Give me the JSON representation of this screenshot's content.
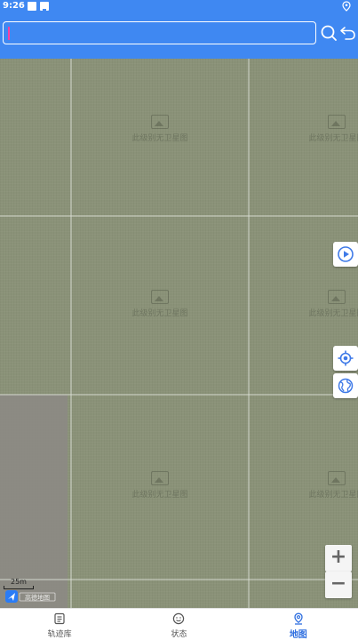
{
  "status_bar": {
    "time": "9:26",
    "icons": [
      "square-icon",
      "notification-icon",
      "location-icon"
    ]
  },
  "search": {
    "value": "",
    "placeholder": "",
    "search_icon": "search-icon",
    "back_icon": "return-icon"
  },
  "map": {
    "tile_placeholder_text": "此级别无卫星图",
    "scale_label": "25m",
    "logo_text": "高德地图",
    "controls": {
      "play": "play-icon",
      "locate": "locate-icon",
      "layers": "globe-icon",
      "zoom_in": "+",
      "zoom_out": "−"
    }
  },
  "bottom_nav": {
    "tabs": [
      {
        "label": "轨迹库",
        "icon": "list-doc-icon",
        "active": false
      },
      {
        "label": "状态",
        "icon": "smile-icon",
        "active": false
      },
      {
        "label": "地图",
        "icon": "map-pin-icon",
        "active": true
      }
    ]
  },
  "colors": {
    "primary": "#3f88f2",
    "map_bg": "#8a9278",
    "active_tab": "#2f6fe0",
    "control_icon": "#3f7ae8"
  }
}
